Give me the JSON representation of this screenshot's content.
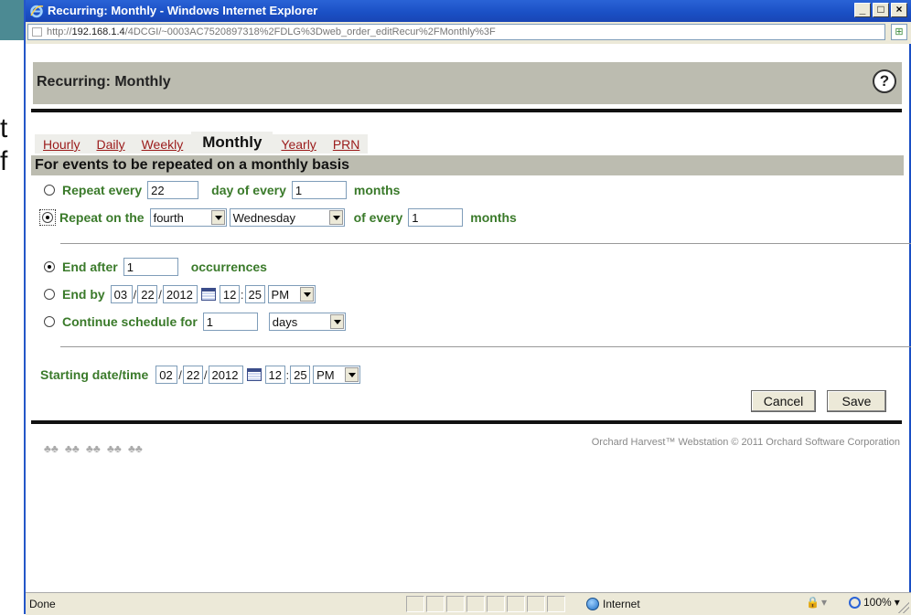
{
  "background": {
    "partial_chars": [
      "t",
      "f"
    ]
  },
  "window": {
    "title": "Recurring: Monthly - Windows Internet Explorer",
    "controls": [
      "_",
      "□",
      "×"
    ]
  },
  "address": {
    "url_prefix": "http://",
    "url_host": "192.168.1.4",
    "url_path": "/4DCGI/~0003AC7520897318%2FDLG%3Dweb_order_editRecur%2FMonthly%3F"
  },
  "page": {
    "title": "Recurring: Monthly",
    "help_label": "?",
    "tabs": [
      {
        "label": "Hourly",
        "active": false
      },
      {
        "label": "Daily",
        "active": false
      },
      {
        "label": "Weekly",
        "active": false
      },
      {
        "label": "Monthly",
        "active": true
      },
      {
        "label": "Yearly",
        "active": false
      },
      {
        "label": "PRN",
        "active": false
      }
    ],
    "section_title": "For events to be repeated on a monthly basis",
    "repeat_every": {
      "label": "Repeat every",
      "day_value": "22",
      "mid_label": "day of every",
      "months_value": "1",
      "suffix": "months",
      "selected": false
    },
    "repeat_on": {
      "label": "Repeat on the",
      "ordinal_value": "fourth",
      "weekday_value": "Wednesday",
      "mid_label": "of every",
      "months_value": "1",
      "suffix": "months",
      "selected": true
    },
    "end_after": {
      "label": "End after",
      "value": "1",
      "suffix": "occurrences",
      "selected": true
    },
    "end_by": {
      "label": "End by",
      "month": "03",
      "day": "22",
      "year": "2012",
      "hour": "12",
      "minute": "25",
      "ampm": "PM",
      "selected": false
    },
    "continue_for": {
      "label": "Continue schedule for",
      "value": "1",
      "unit": "days",
      "selected": false
    },
    "starting": {
      "label": "Starting date/time",
      "month": "02",
      "day": "22",
      "year": "2012",
      "hour": "12",
      "minute": "25",
      "ampm": "PM"
    },
    "buttons": {
      "cancel": "Cancel",
      "save": "Save"
    },
    "footer": "Orchard Harvest™ Webstation © 2011 Orchard Software Corporation"
  },
  "status": {
    "text": "Done",
    "zone": "Internet",
    "zoom": "100%"
  },
  "colors": {
    "label_green": "#3a7a2a",
    "tab_link_red": "#9b1b1b",
    "band_gray": "#bcbcb0",
    "titlebar_blue": "#2a63d6"
  }
}
